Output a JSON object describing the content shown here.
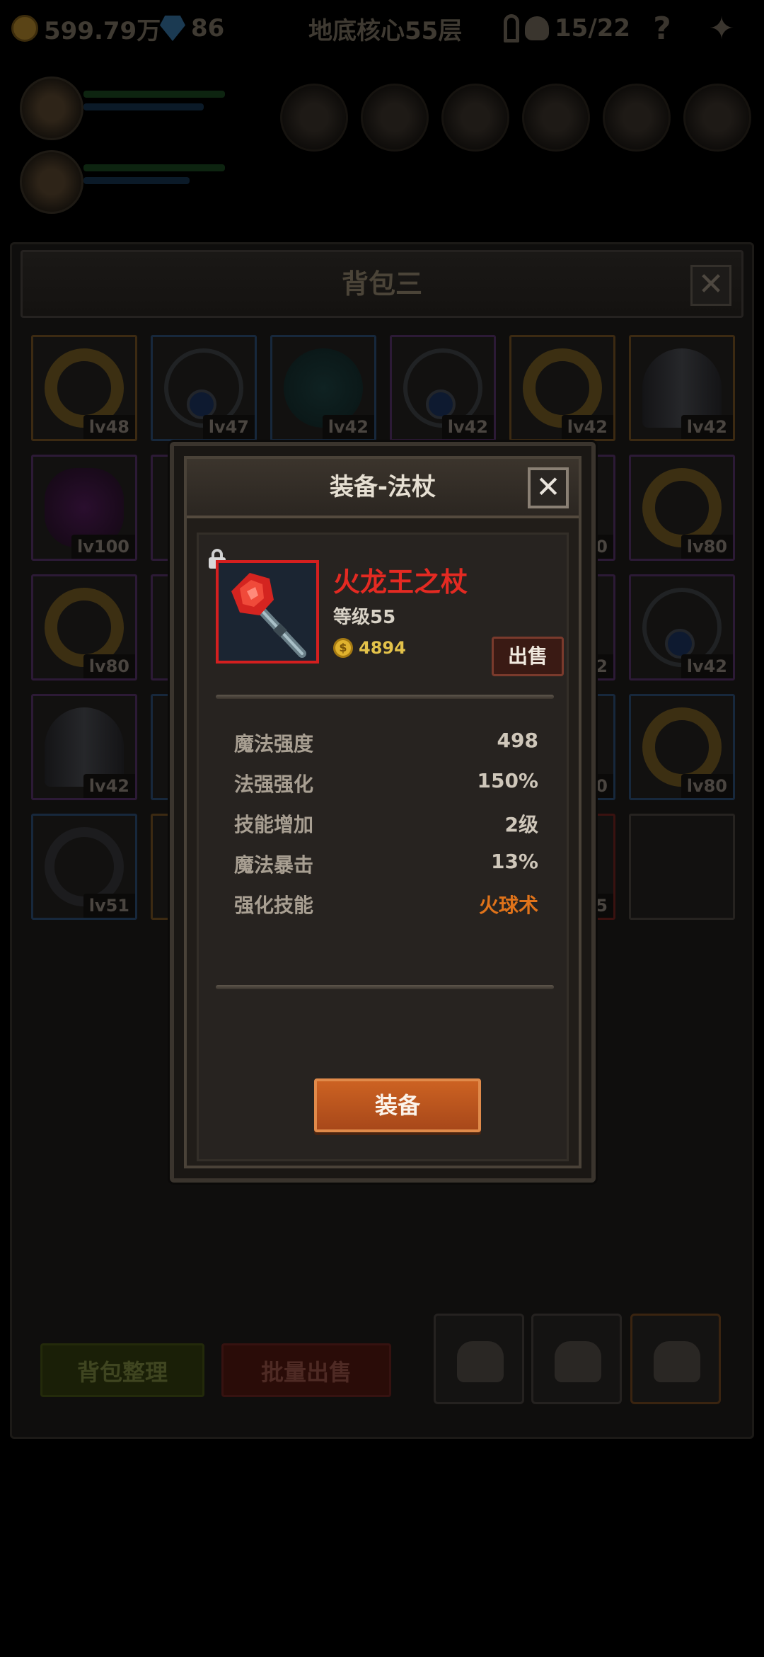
{
  "hud": {
    "gold": "599.79万",
    "gems": "86",
    "location": "地底核心55层",
    "kills": "15/22",
    "help_label": "?"
  },
  "backpack": {
    "title": "背包三",
    "close_label": "✕",
    "slots": [
      {
        "lv": "lv48",
        "art": "ring",
        "quality": "orange"
      },
      {
        "lv": "lv47",
        "art": "amulet",
        "quality": "blue"
      },
      {
        "lv": "lv42",
        "art": "orb",
        "quality": "blue"
      },
      {
        "lv": "lv42",
        "art": "amulet",
        "quality": "purple"
      },
      {
        "lv": "lv42",
        "art": "ring",
        "quality": "orange"
      },
      {
        "lv": "lv42",
        "art": "helm",
        "quality": "orange"
      },
      {
        "lv": "lv100",
        "art": "glove",
        "quality": "purple"
      },
      {
        "lv": "",
        "art": "",
        "quality": "purple"
      },
      {
        "lv": "",
        "art": "",
        "quality": ""
      },
      {
        "lv": "",
        "art": "",
        "quality": ""
      },
      {
        "lv": "00",
        "art": "",
        "quality": "purple"
      },
      {
        "lv": "lv80",
        "art": "ring",
        "quality": "purple"
      },
      {
        "lv": "lv80",
        "art": "ring",
        "quality": "purple"
      },
      {
        "lv": "",
        "art": "",
        "quality": "purple"
      },
      {
        "lv": "",
        "art": "",
        "quality": ""
      },
      {
        "lv": "",
        "art": "",
        "quality": ""
      },
      {
        "lv": "2",
        "art": "",
        "quality": "purple"
      },
      {
        "lv": "lv42",
        "art": "amulet",
        "quality": "purple"
      },
      {
        "lv": "lv42",
        "art": "helm",
        "quality": "purple"
      },
      {
        "lv": "",
        "art": "",
        "quality": "blue"
      },
      {
        "lv": "",
        "art": "",
        "quality": ""
      },
      {
        "lv": "",
        "art": "",
        "quality": ""
      },
      {
        "lv": "0",
        "art": "",
        "quality": "blue"
      },
      {
        "lv": "lv80",
        "art": "ring",
        "quality": "blue"
      },
      {
        "lv": "lv51",
        "art": "ring-dark",
        "quality": "blue"
      },
      {
        "lv": "",
        "art": "",
        "quality": "orange"
      },
      {
        "lv": "",
        "art": "",
        "quality": ""
      },
      {
        "lv": "",
        "art": "",
        "quality": ""
      },
      {
        "lv": "5",
        "art": "",
        "quality": "red"
      },
      {
        "lv": "",
        "art": "",
        "quality": ""
      }
    ],
    "sort_label": "背包整理",
    "bulk_sell_label": "批量出售"
  },
  "dialog": {
    "title": "装备-法杖",
    "close_label": "✕",
    "item": {
      "name": "火龙王之杖",
      "level": "等级55",
      "price": "4894",
      "name_color": "#e42a22",
      "frame_color": "#d41f1f"
    },
    "sell_label": "出售",
    "stats": [
      {
        "key": "魔法强度",
        "value": "498"
      },
      {
        "key": "法强强化",
        "value": "150%"
      },
      {
        "key": "技能增加",
        "value": "2级"
      },
      {
        "key": "魔法暴击",
        "value": "13%"
      },
      {
        "key": "强化技能",
        "value": "火球术",
        "highlight": true
      }
    ],
    "equip_label": "装备"
  }
}
